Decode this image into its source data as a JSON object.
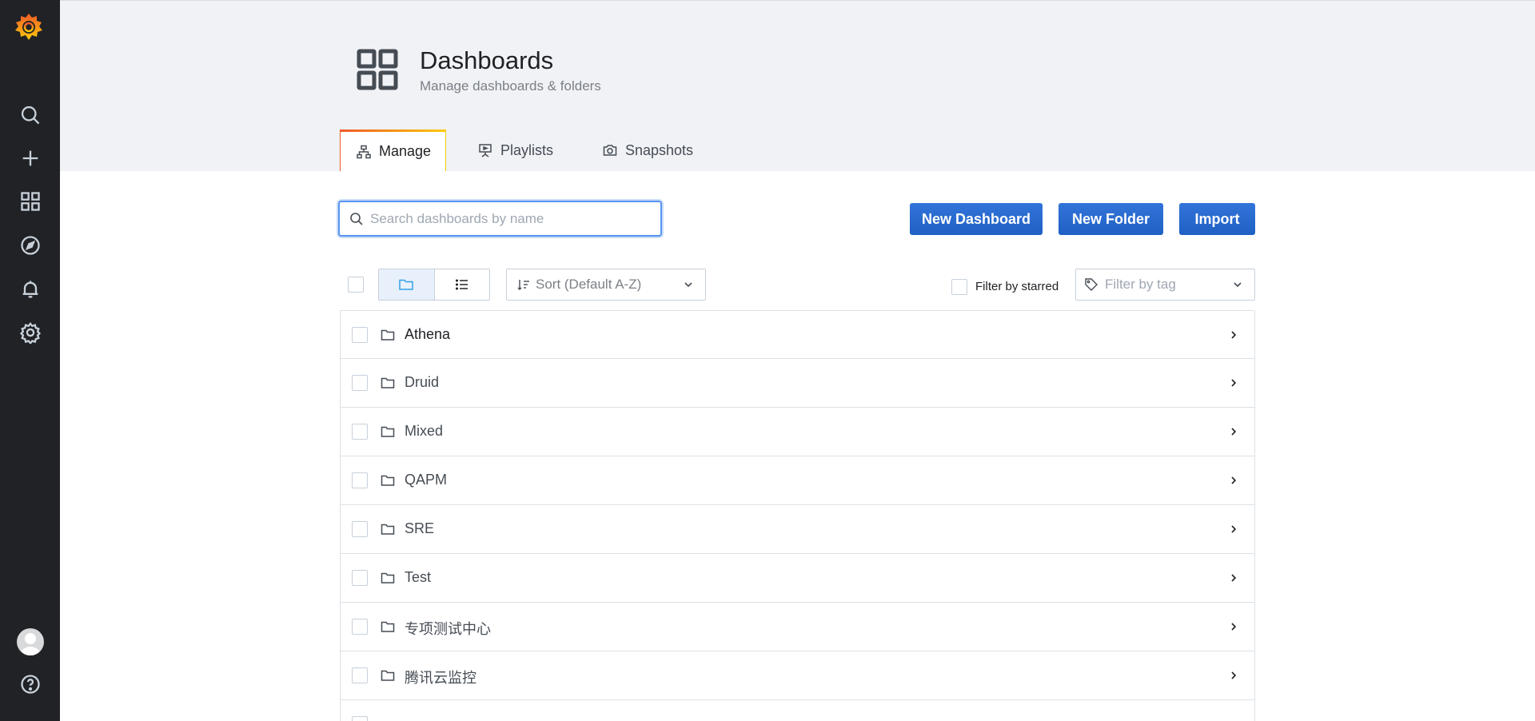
{
  "sidebar": {
    "icons": [
      "grafana-logo",
      "search-icon",
      "plus-icon",
      "dashboards-icon",
      "explore-icon",
      "bell-icon",
      "gear-icon",
      "avatar",
      "help-icon"
    ]
  },
  "header": {
    "title": "Dashboards",
    "subtitle": "Manage dashboards & folders",
    "tabs": [
      {
        "label": "Manage",
        "active": true
      },
      {
        "label": "Playlists",
        "active": false
      },
      {
        "label": "Snapshots",
        "active": false
      }
    ]
  },
  "actions": {
    "search_placeholder": "Search dashboards by name",
    "new_dashboard": "New Dashboard",
    "new_folder": "New Folder",
    "import": "Import"
  },
  "toolbar": {
    "sort": "Sort (Default A-Z)",
    "filter_starred": "Filter by starred",
    "filter_tag_placeholder": "Filter by tag"
  },
  "folders": [
    {
      "name": "Athena"
    },
    {
      "name": "Druid"
    },
    {
      "name": "Mixed"
    },
    {
      "name": "QAPM"
    },
    {
      "name": "SRE"
    },
    {
      "name": "Test"
    },
    {
      "name": "专项测试中心"
    },
    {
      "name": "腾讯云监控"
    }
  ],
  "colors": {
    "sidebar_bg": "#202226",
    "header_bg": "#f0f2f6",
    "primary_button": "#1f60c4",
    "tab_accent": "#f05a28"
  }
}
